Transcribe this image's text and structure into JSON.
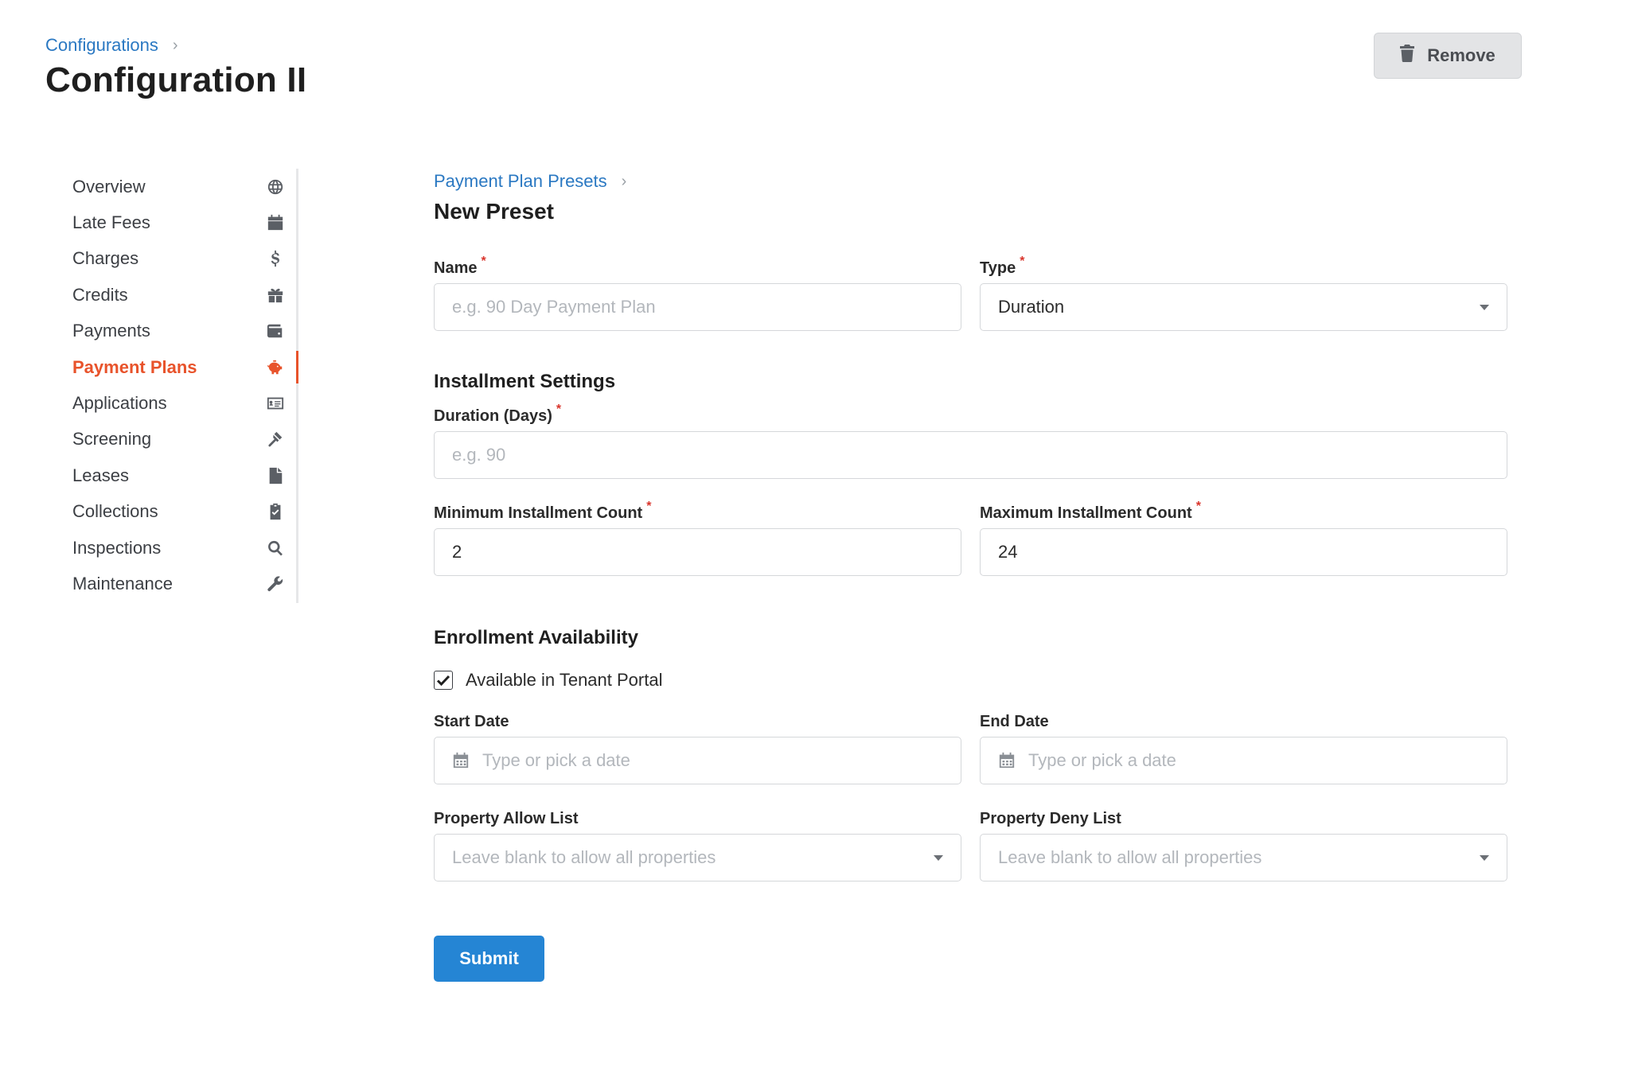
{
  "header": {
    "breadcrumb": "Configurations",
    "title": "Configuration II",
    "remove_label": "Remove"
  },
  "sidebar": {
    "items": [
      {
        "label": "Overview",
        "icon": "globe-icon"
      },
      {
        "label": "Late Fees",
        "icon": "calendar-icon"
      },
      {
        "label": "Charges",
        "icon": "dollar-icon"
      },
      {
        "label": "Credits",
        "icon": "gift-icon"
      },
      {
        "label": "Payments",
        "icon": "wallet-icon"
      },
      {
        "label": "Payment Plans",
        "icon": "piggy-bank-icon",
        "active": true
      },
      {
        "label": "Applications",
        "icon": "id-card-icon"
      },
      {
        "label": "Screening",
        "icon": "gavel-icon"
      },
      {
        "label": "Leases",
        "icon": "file-icon"
      },
      {
        "label": "Collections",
        "icon": "clipboard-check-icon"
      },
      {
        "label": "Inspections",
        "icon": "search-icon"
      },
      {
        "label": "Maintenance",
        "icon": "wrench-icon"
      }
    ],
    "active_color": "#e8532b"
  },
  "form": {
    "breadcrumb": "Payment Plan Presets",
    "title": "New Preset",
    "name": {
      "label": "Name",
      "placeholder": "e.g. 90 Day Payment Plan",
      "value": ""
    },
    "type": {
      "label": "Type",
      "value": "Duration"
    },
    "installment_section": "Installment Settings",
    "duration": {
      "label": "Duration (Days)",
      "placeholder": "e.g. 90",
      "value": ""
    },
    "min_count": {
      "label": "Minimum Installment Count",
      "value": "2"
    },
    "max_count": {
      "label": "Maximum Installment Count",
      "value": "24"
    },
    "enrollment_section": "Enrollment Availability",
    "tenant_portal": {
      "label": "Available in Tenant Portal",
      "checked": true
    },
    "start_date": {
      "label": "Start Date",
      "placeholder": "Type or pick a date"
    },
    "end_date": {
      "label": "End Date",
      "placeholder": "Type or pick a date"
    },
    "allow_list": {
      "label": "Property Allow List",
      "placeholder": "Leave blank to allow all properties"
    },
    "deny_list": {
      "label": "Property Deny List",
      "placeholder": "Leave blank to allow all properties"
    },
    "required_marker": "*",
    "submit_label": "Submit"
  },
  "colors": {
    "link": "#2a78c2",
    "primary_button": "#2585d4",
    "required": "#d9342b"
  }
}
